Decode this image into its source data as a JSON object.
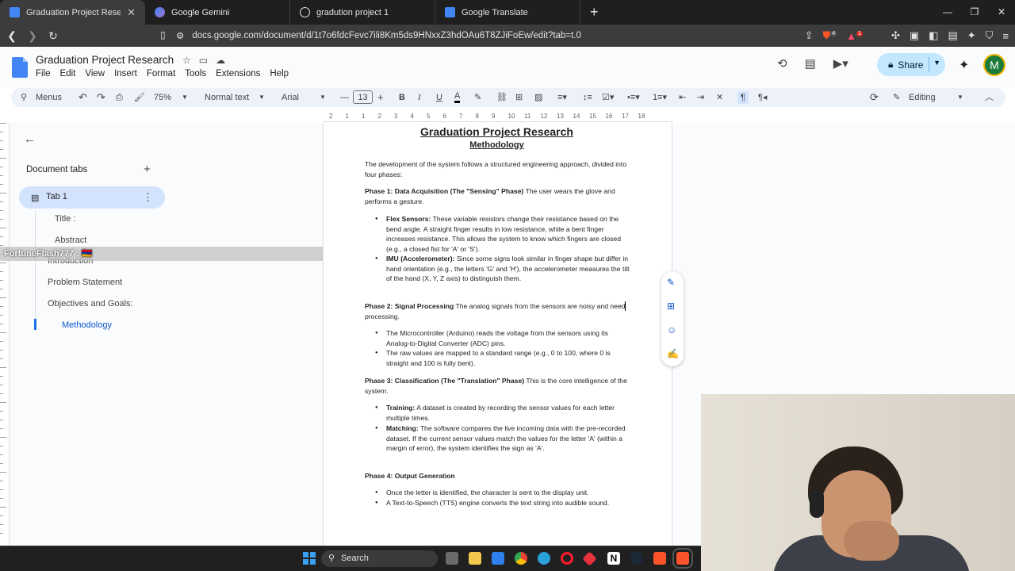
{
  "browser": {
    "tabs": [
      {
        "title": "Graduation Project Research - Goog",
        "icon": "docs-icon",
        "active": true
      },
      {
        "title": "Google Gemini",
        "icon": "gemini-icon",
        "active": false
      },
      {
        "title": "gradution project 1",
        "icon": "chatgpt-icon",
        "active": false
      },
      {
        "title": "Google Translate",
        "icon": "translate-icon",
        "active": false
      }
    ],
    "close_glyph": "✕",
    "new_tab_glyph": "+",
    "url": "docs.google.com/document/d/1t7o6fdcFevc7ili8Km5ds9HNxxZ3hdOAu6T8ZJiFoEw/edit?tab=t.0",
    "badges": {
      "brave": "4",
      "alert": "1"
    }
  },
  "docs": {
    "title": "Graduation Project Research",
    "menu": [
      "File",
      "Edit",
      "View",
      "Insert",
      "Format",
      "Tools",
      "Extensions",
      "Help"
    ],
    "share_label": "Share",
    "avatar_letter": "M"
  },
  "toolbar": {
    "menus_label": "Menus",
    "zoom": "75%",
    "style": "Normal text",
    "font": "Arial",
    "font_size": "13",
    "mode": "Editing"
  },
  "ruler": {
    "numbers": [
      "2",
      "1",
      "1",
      "2",
      "3",
      "4",
      "5",
      "6",
      "7",
      "8",
      "9",
      "10",
      "11",
      "12",
      "13",
      "14",
      "15",
      "16",
      "17",
      "18"
    ]
  },
  "sidebar": {
    "heading": "Document tabs",
    "tab_label": "Tab 1",
    "outline": [
      "Title :",
      "Abstract",
      "Introduction",
      "Problem Statement",
      "Objectives and Goals:",
      "Methodology"
    ],
    "overlay_text": "FortuneFlash777 : 🇦🇲"
  },
  "document": {
    "h1": "Graduation Project Research",
    "h2": "Methodology",
    "intro": "The development of the system follows a structured engineering approach, divided into four phases:",
    "phase1_head": "Phase 1: Data Acquisition (The \"Sensing\" Phase)",
    "phase1_text": " The user wears the glove and performs a gesture.",
    "p1_b1_head": "Flex Sensors:",
    "p1_b1_text": " These variable resistors change their resistance based on the bend angle. A straight finger results in low resistance, while a bent finger increases resistance. This allows the system to know which fingers are closed (e.g., a closed fist for 'A' or 'S').",
    "p1_b2_head": "IMU (Accelerometer):",
    "p1_b2_text": " Since some signs look similar in finger shape but differ in hand orientation (e.g., the letters 'G' and 'H'), the accelerometer measures the tilt of the hand (X, Y, Z axis) to distinguish them.",
    "phase2_head": "Phase 2: Signal Processing",
    "phase2_text": " The analog signals from the sensors are noisy and need processing.",
    "p2_b1": "The Microcontroller (Arduino) reads the voltage from the sensors using its Analog-to-Digital Converter (ADC) pins.",
    "p2_b2": "The raw values are mapped to a standard range (e.g., 0 to 100, where 0 is straight and 100 is fully bent).",
    "phase3_head": "Phase 3: Classification (The \"Translation\" Phase)",
    "phase3_text": " This is the core intelligence of the system.",
    "p3_b1_head": "Training:",
    "p3_b1_text": " A dataset is created by recording the sensor values for each letter multiple times.",
    "p3_b2_head": "Matching:",
    "p3_b2_text": " The software compares the live incoming data with the pre-recorded dataset. If the current sensor values match the values for the letter 'A' (within a margin of error), the system identifies the sign as 'A'.",
    "phase4_head": "Phase 4: Output Generation",
    "p4_b1": "Once the letter is identified, the character is sent to the display unit.",
    "p4_b2": "A Text-to-Speech (TTS) engine converts the text string into audible sound."
  },
  "taskbar": {
    "search_label": "Search"
  },
  "colors": {
    "accent": "#0b57d0",
    "share_bg": "#c2e7ff",
    "tab_pill": "#d3e3fd",
    "chrome_dark": "#1f1f1f"
  }
}
